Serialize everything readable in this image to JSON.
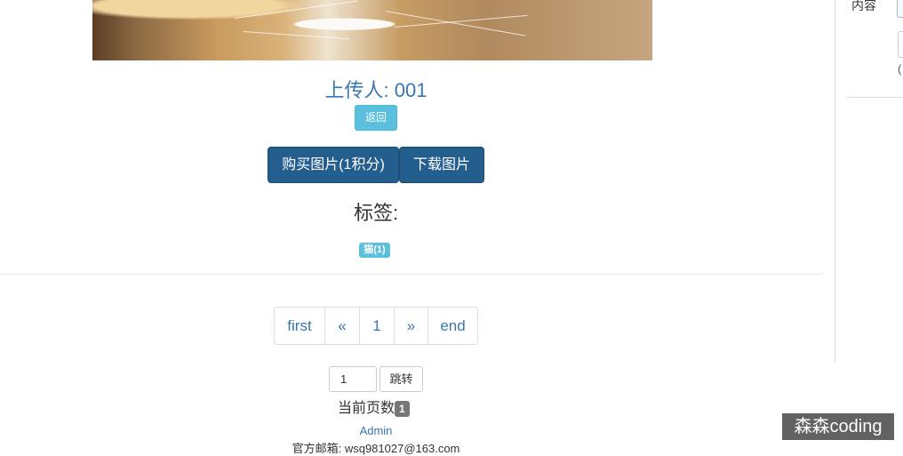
{
  "image": {
    "alt": "cat photo"
  },
  "uploader": {
    "text": "上传人: 001"
  },
  "buttons": {
    "back": "返回",
    "buy": "购买图片(1积分)",
    "download": "下载图片"
  },
  "tags": {
    "title": "标签:",
    "items": [
      {
        "label": "猫(1)"
      }
    ]
  },
  "pagination": {
    "first": "first",
    "prev": "«",
    "page": "1",
    "next": "»",
    "end": "end"
  },
  "jump": {
    "value": "1",
    "button": "跳转"
  },
  "current_page": {
    "label": "当前页数",
    "value": "1"
  },
  "footer": {
    "admin": "Admin",
    "email": "官方邮箱: wsq981027@163.com"
  },
  "sidebar": {
    "label": "内容",
    "paren": "("
  },
  "watermark": "森森coding",
  "colors": {
    "link": "#3a76b0",
    "info": "#5bc0de",
    "primary": "#245e8f"
  }
}
